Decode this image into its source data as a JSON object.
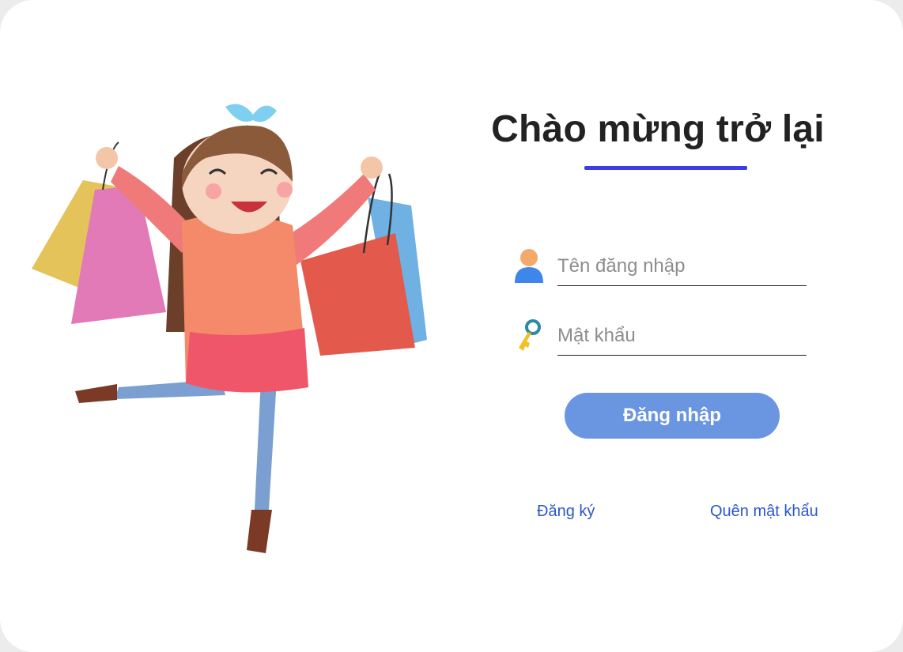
{
  "title": "Chào mừng trở lại",
  "form": {
    "username": {
      "placeholder": "Tên đăng nhập",
      "value": "",
      "icon": "user-icon"
    },
    "password": {
      "placeholder": "Mật khẩu",
      "value": "",
      "icon": "key-icon"
    }
  },
  "buttons": {
    "login_label": "Đăng nhập"
  },
  "links": {
    "register": "Đăng ký",
    "forgot_password": "Quên mật khẩu"
  },
  "colors": {
    "accent_underline": "#3b3ce6",
    "button_bg": "#6a95e0",
    "link": "#2c57c8",
    "title": "#222222"
  }
}
